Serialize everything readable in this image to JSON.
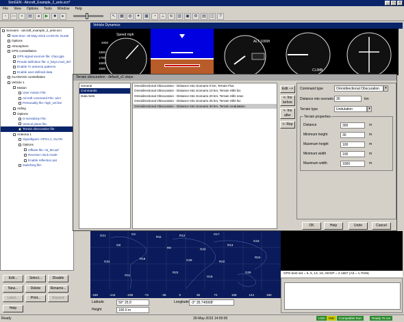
{
  "window": {
    "title": "SimGEN - Aircraft_Example_2_ants.scn*"
  },
  "menu": [
    "File",
    "View",
    "Options",
    "Tools",
    "Window",
    "Help"
  ],
  "tree": [
    {
      "label": "Scenario - aircraft_example_2_ants.scn",
      "level": 0,
      "link": false
    },
    {
      "label": "Start time: 30-May-2015 14:00:00, Durati",
      "level": 1,
      "link": true
    },
    {
      "label": "Options",
      "level": 1,
      "link": false
    },
    {
      "label": "Atmosphere",
      "level": 1,
      "link": false
    },
    {
      "label": "GPS constellation",
      "level": 1,
      "link": false
    },
    {
      "label": "GPS signal sources file: chan.gps",
      "level": 2,
      "link": true
    },
    {
      "label": "Pmode definition file: 2_beys.mod_def",
      "level": 2,
      "link": true
    },
    {
      "label": "Enable Tx antenna patterns",
      "level": 2,
      "link": true
    },
    {
      "label": "Enable user-defined data",
      "level": 2,
      "link": true
    },
    {
      "label": "GLONASS constellation",
      "level": 1,
      "link": false
    },
    {
      "label": "Vehicle 1",
      "level": 1,
      "link": false
    },
    {
      "label": "Motion",
      "level": 2,
      "link": false
    },
    {
      "label": "User motion File:",
      "level": 3,
      "link": true
    },
    {
      "label": "Aircraft command File: aircr",
      "level": 3,
      "link": true
    },
    {
      "label": "Personality file: high_vel.fee",
      "level": 3,
      "link": true
    },
    {
      "label": "Aiding",
      "level": 2,
      "link": false
    },
    {
      "label": "Options",
      "level": 2,
      "link": false
    },
    {
      "label": "G-sensitivity File:",
      "level": 3,
      "link": true
    },
    {
      "label": "Vertical plane file:",
      "level": 3,
      "link": true
    },
    {
      "label": "Terrain obscuration file:",
      "level": 3,
      "link": true
    },
    {
      "label": "Antenna 1",
      "level": 2,
      "link": false
    },
    {
      "label": "Signaltypes: GPS:L1, GLON",
      "level": 3,
      "link": true
    },
    {
      "label": "Options",
      "level": 3,
      "link": false
    },
    {
      "label": "Offsets file: rst_90.aof",
      "level": 4,
      "link": true
    },
    {
      "label": "Receiver clock mode",
      "level": 4,
      "link": true
    },
    {
      "label": "Enable reflection pat",
      "level": 4,
      "link": true
    },
    {
      "label": "Switching file:",
      "level": 3,
      "link": true
    }
  ],
  "left_buttons": [
    [
      "Edit...",
      "Select...",
      "Disable"
    ],
    [
      "New...",
      "Delete",
      "Rename..."
    ],
    [
      "Label...",
      "Print...",
      "Expand"
    ],
    [
      "Help"
    ]
  ],
  "vehicle_dynamics": {
    "title": "Vehicle Dynamics",
    "speed_label": "Speed mph",
    "alt_label": "ALT 1000ft",
    "climb_label": "CLIMB",
    "speed_ticks": [
      "2000",
      "1800",
      "1700",
      "1600",
      "1500"
    ]
  },
  "dialog": {
    "title": "Terrain obscuration - default_v1 steps",
    "nav": [
      "General",
      "Commands",
      "Data Sets"
    ],
    "commands": [
      "Omnidirectional Obscuration - Distance Into Scenario 0 km, Terrain Flat.",
      "Omnidirectional Obscuration - Distance Into Scenario 10 km, Terrain Hills far.",
      "Omnidirectional Obscuration - Distance Into Scenario 20 km, Terrain Hills near.",
      "Omnidirectional Obscuration - Distance Into Scenario 25 km, Terrain Hills far.",
      "Omnidirectional Obscuration - Distance Into Scenario 30 km, Terrain Undulation."
    ],
    "side_buttons": [
      "Edit -->",
      "<- Ins before",
      "<- Ins after",
      "<- Rep"
    ],
    "command_type_label": "Command type",
    "command_type_value": "Omnidirectional Obscuration",
    "distance_label": "Distance into scenario",
    "distance_value": "30",
    "distance_unit": "km",
    "terrain_type_label": "Terrain type",
    "terrain_type_value": "Undulation",
    "props_title": "Terrain properties",
    "props": [
      {
        "label": "Distance",
        "value": "300",
        "unit": "m"
      },
      {
        "label": "Minimum height",
        "value": "30",
        "unit": "m"
      },
      {
        "label": "Maximum height",
        "value": "100",
        "unit": "m"
      },
      {
        "label": "Minimum width",
        "value": "100",
        "unit": "m"
      },
      {
        "label": "Maximum width",
        "value": "1000",
        "unit": "m"
      }
    ],
    "bottom_buttons": [
      "OK",
      "Help",
      "Undo",
      "Cancel"
    ]
  },
  "map": {
    "lon_ticks": [
      "-180",
      "-144",
      "-108",
      "-72",
      "-36",
      "0",
      "36",
      "72",
      "108",
      "144",
      "180"
    ],
    "latitude_label": "Latitude",
    "latitude_value": "50° 25.5'",
    "longitude_label": "Longitude",
    "longitude_value": "-3° 35.749998'",
    "height_label": "Height",
    "height_value": "100.0 m",
    "satellites": [
      "G21",
      "G2",
      "R11",
      "R12",
      "G17",
      "G8",
      "R9",
      "G24",
      "R13",
      "G18",
      "G31",
      "R18",
      "G26",
      "R22",
      "R24",
      "G11",
      "R23",
      "G16",
      "G25"
    ]
  },
  "gps_panel": {
    "status_text": "GPS best set = 5, 5, 13, 19, GDOP = 2.1657 (Alt = 1.7048)"
  },
  "status_bar": {
    "left": "Ready",
    "time": "30-May-2015 14:00:00",
    "pills": [
      {
        "text": "LOG",
        "color": "#2e8b2e"
      },
      {
        "text": "HW",
        "color": "#c8c800"
      },
      {
        "text": "Compatible Run",
        "color": "#2e8b2e"
      },
      {
        "text": "Ready To run",
        "color": "#2e8b2e"
      }
    ]
  }
}
